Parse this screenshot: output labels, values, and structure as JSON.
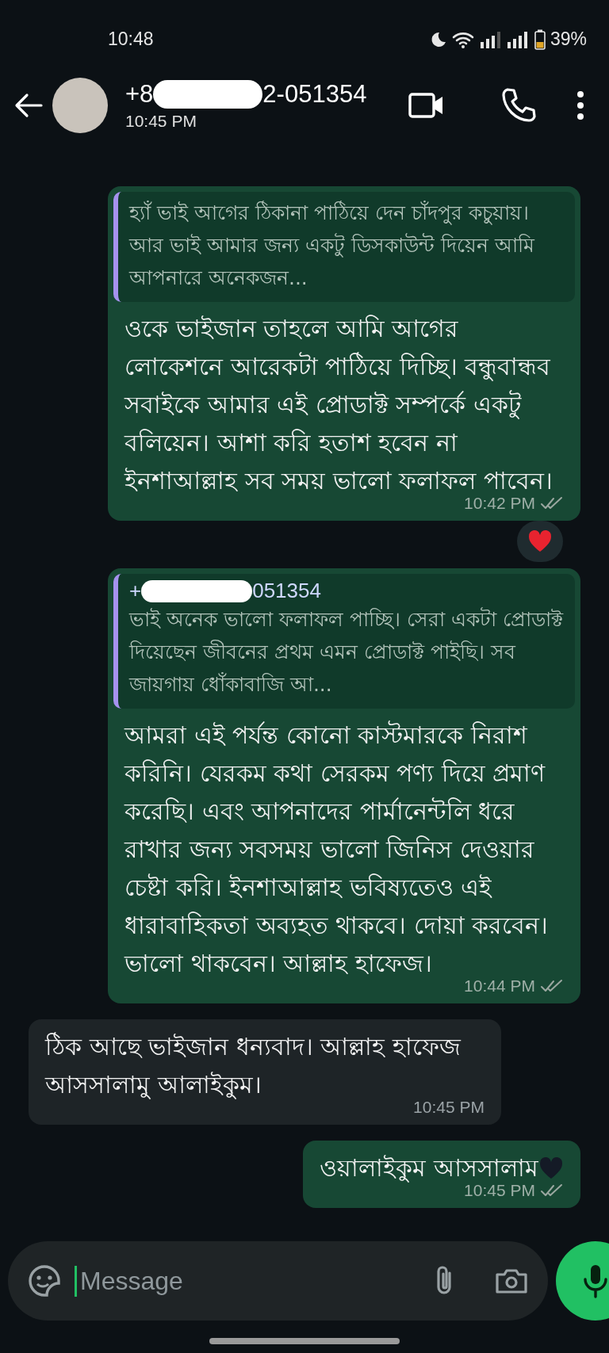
{
  "status_bar": {
    "time": "10:48",
    "battery": "39%"
  },
  "header": {
    "name_start": "+8",
    "name_end": "2-051354",
    "subtitle": "10:45 PM"
  },
  "messages": [
    {
      "kind": "outgoing",
      "quote": {
        "text": "হ্যাঁ ভাই আগের ঠিকানা পাঠিয়ে দেন চাঁদপুর কচুয়ায়। আর ভাই আমার জন্য একটু ডিসকাউন্ট দিয়েন আমি আপনারে অনেকজন..."
      },
      "text": "ওকে ভাইজান তাহলে আমি আগের লোকেশনে আরেকটা পাঠিয়ে দিচ্ছি। বন্ধুবান্ধব সবাইকে আমার এই প্রোডাক্ট সম্পর্কে একটু বলিয়েন। আশা করি হতাশ হবেন না ইনশাআল্লাহ সব সময় ভালো ফলাফল পাবেন।",
      "time": "10:42 PM",
      "read": false,
      "reaction": true
    },
    {
      "kind": "outgoing",
      "quote": {
        "sender_start": "+",
        "sender_end": "051354",
        "text": "ভাই অনেক ভালো ফলাফল পাচ্ছি। সেরা একটা প্রোডাক্ট দিয়েছেন জীবনের প্রথম এমন প্রোডাক্ট পাইছি। সব জায়গায় ধোঁকাবাজি আ..."
      },
      "text": "আমরা এই পর্যন্ত কোনো কাস্টমারকে নিরাশ করিনি। যেরকম কথা সেরকম পণ্য দিয়ে প্রমাণ করেছি। এবং আপনাদের পার্মানেন্টলি ধরে রাখার জন্য সবসময় ভালো জিনিস দেওয়ার চেষ্টা করি। ইনশাআল্লাহ ভবিষ্যতেও এই ধারাবাহিকতা অব্যহত থাকবে। দোয়া করবেন। ভালো থাকবেন। আল্লাহ হাফেজ।",
      "time": "10:44 PM",
      "read": false
    },
    {
      "kind": "incoming",
      "text": "ঠিক আছে ভাইজান ধন্যবাদ। আল্লাহ হাফেজ আসসালামু আলাইকুম।",
      "time": "10:45 PM"
    },
    {
      "kind": "outgoing",
      "text": "ওয়ালাইকুম আসসালাম",
      "heart": true,
      "time": "10:45 PM",
      "read": false
    }
  ],
  "composer": {
    "placeholder": "Message"
  }
}
